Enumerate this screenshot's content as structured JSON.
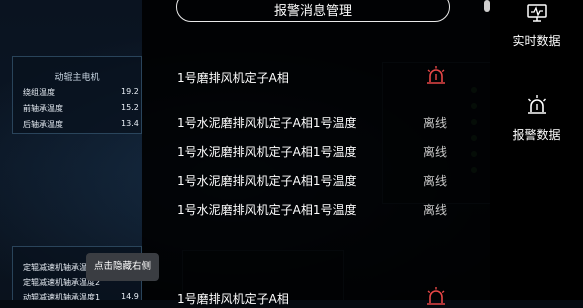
{
  "background": {
    "motor_panel": {
      "title": "动辊主电机",
      "rows": [
        {
          "label": "绕组温度",
          "value": "19.2"
        },
        {
          "label": "前轴承温度",
          "value": "15.2"
        },
        {
          "label": "后轴承温度",
          "value": "13.4"
        }
      ]
    },
    "reducer_panel": {
      "rows": [
        {
          "label": "定辊减速机轴承温度",
          "value": ""
        },
        {
          "label": "定辊减速机轴承温度2",
          "value": ""
        },
        {
          "label": "动辊减速机轴承温度1",
          "value": "14.9"
        }
      ]
    }
  },
  "drawer": {
    "title": "报警消息管理",
    "alarms": [
      {
        "text": "1号磨排风机定子A相",
        "status": "",
        "icon": "alarm-bell-icon"
      },
      {
        "text": "1号水泥磨排风机定子A相1号温度",
        "status": "离线",
        "icon": ""
      },
      {
        "text": "1号水泥磨排风机定子A相1号温度",
        "status": "离线",
        "icon": ""
      },
      {
        "text": "1号水泥磨排风机定子A相1号温度",
        "status": "离线",
        "icon": ""
      },
      {
        "text": "1号水泥磨排风机定子A相1号温度",
        "status": "离线",
        "icon": ""
      },
      {
        "text": "1号磨排风机定子A相",
        "status": "",
        "icon": "alarm-bell-icon"
      }
    ],
    "colors": {
      "alarm": "#e64646",
      "offline": "#c7c7c7"
    }
  },
  "sidebar": {
    "items": [
      {
        "label": "实时数据",
        "icon": "monitor-icon"
      },
      {
        "label": "报警数据",
        "icon": "alarm-light-icon"
      }
    ]
  },
  "tooltip": {
    "text": "点击隐藏右侧"
  }
}
